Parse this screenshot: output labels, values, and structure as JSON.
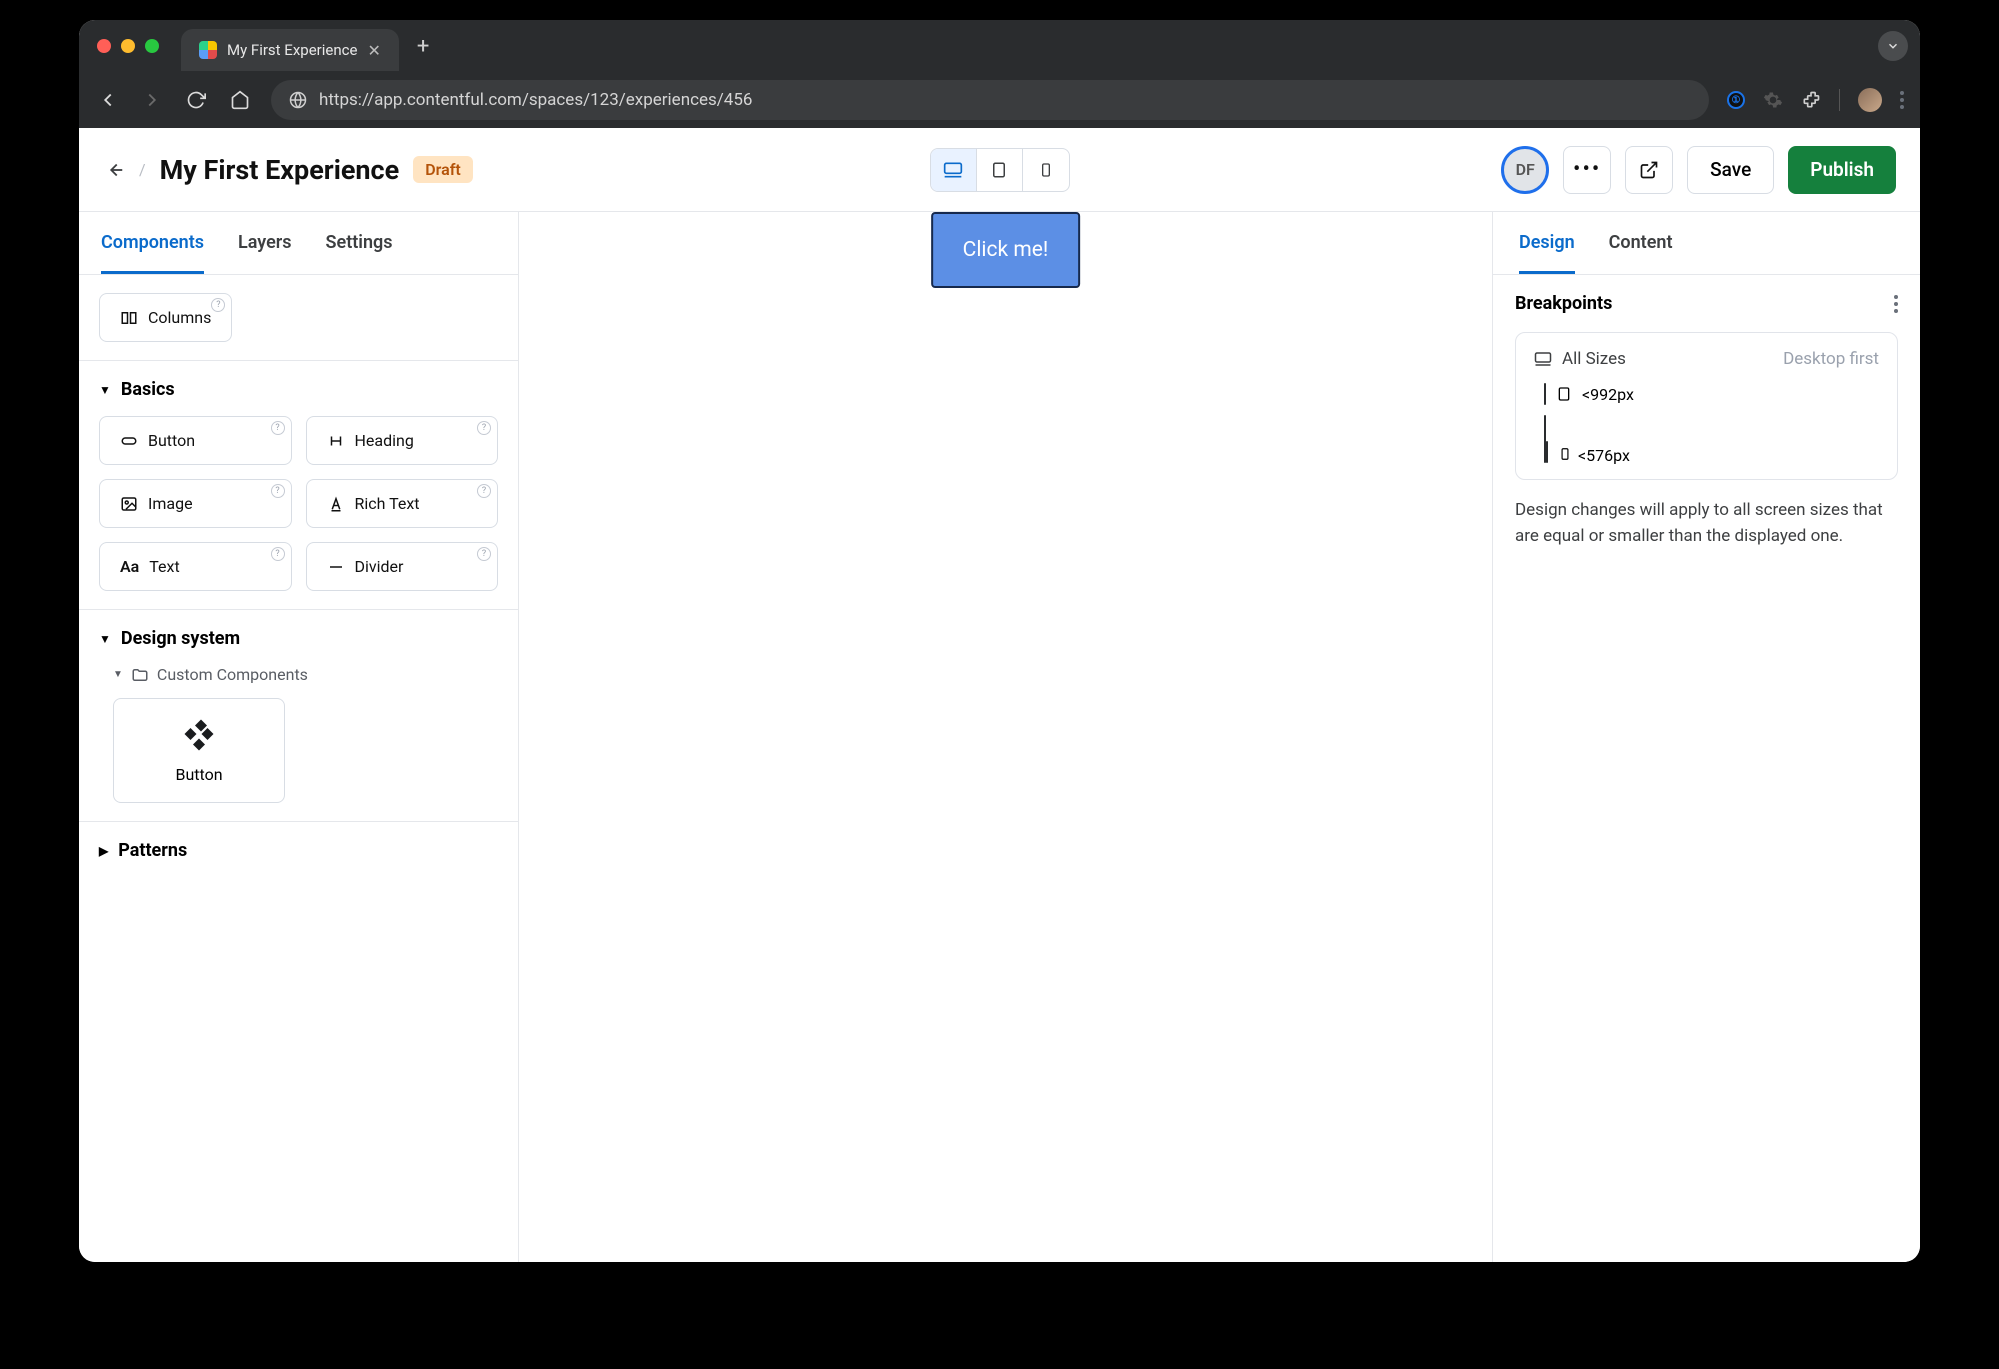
{
  "browser": {
    "tab_title": "My First Experience",
    "url": "https://app.contentful.com/spaces/123/experiences/456"
  },
  "header": {
    "title": "My First Experience",
    "status_badge": "Draft",
    "user_initials": "DF",
    "save_label": "Save",
    "publish_label": "Publish"
  },
  "left": {
    "tabs": {
      "components": "Components",
      "layers": "Layers",
      "settings": "Settings"
    },
    "columns_label": "Columns",
    "basics_heading": "Basics",
    "basics": {
      "button": "Button",
      "heading": "Heading",
      "image": "Image",
      "rich_text": "Rich Text",
      "text": "Text",
      "divider": "Divider"
    },
    "design_system_heading": "Design system",
    "custom_components_heading": "Custom Components",
    "custom_button_label": "Button",
    "patterns_heading": "Patterns"
  },
  "canvas": {
    "button_label": "Click me!"
  },
  "right": {
    "tabs": {
      "design": "Design",
      "content": "Content"
    },
    "breakpoints_heading": "Breakpoints",
    "all_sizes": "All Sizes",
    "desktop_first": "Desktop first",
    "bp_tablet": "<992px",
    "bp_mobile": "<576px",
    "description": "Design changes will apply to all screen sizes that are equal or smaller than the displayed one."
  }
}
